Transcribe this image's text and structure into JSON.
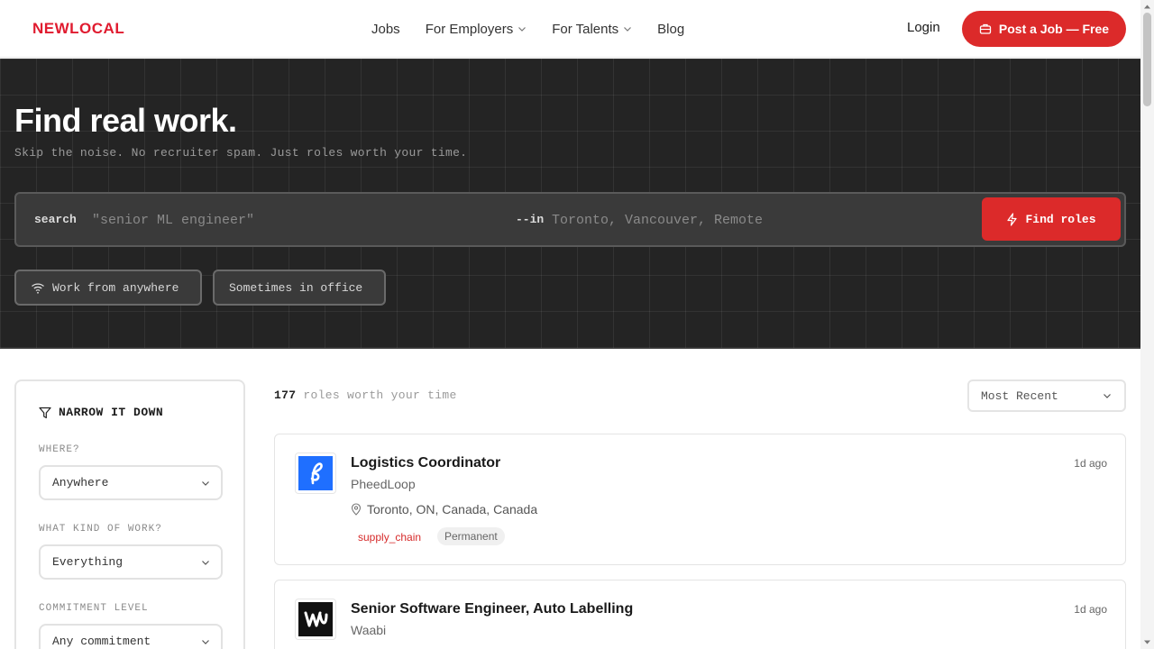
{
  "header": {
    "logo": "NEWLOCAL",
    "nav": [
      {
        "label": "Jobs"
      },
      {
        "label": "For Employers"
      },
      {
        "label": "For Talents"
      },
      {
        "label": "Blog"
      }
    ],
    "login": "Login",
    "post_job": "Post a Job — Free"
  },
  "hero": {
    "title": "Find real work.",
    "subtitle": "Skip the noise. No recruiter spam. Just roles worth your time.",
    "search_label": "search",
    "search_placeholder": "\"senior ML engineer\"",
    "in_label": "--in",
    "location_placeholder": "Toronto, Vancouver, Remote",
    "find_button": "Find roles",
    "chips": [
      "Work from anywhere",
      "Sometimes in office"
    ]
  },
  "filters": {
    "title": "NARROW IT DOWN",
    "where_label": "WHERE?",
    "where_value": "Anywhere",
    "kind_label": "WHAT KIND OF WORK?",
    "kind_value": "Everything",
    "commitment_label": "COMMITMENT LEVEL",
    "commitment_value": "Any commitment"
  },
  "results": {
    "count": "177",
    "count_suffix": "roles worth your time",
    "sort": "Most Recent",
    "jobs": [
      {
        "title": "Logistics Coordinator",
        "company": "PheedLoop",
        "location": "Toronto, ON, Canada, Canada",
        "posted": "1d ago",
        "category": "supply_chain",
        "type": "Permanent",
        "logo_color": "#1f6fff"
      },
      {
        "title": "Senior Software Engineer, Auto Labelling",
        "company": "Waabi",
        "posted": "1d ago",
        "logo_color": "#111111"
      }
    ]
  },
  "colors": {
    "brand": "#e01b2f",
    "accent": "#dc2a2a",
    "hero_bg": "#242424"
  }
}
